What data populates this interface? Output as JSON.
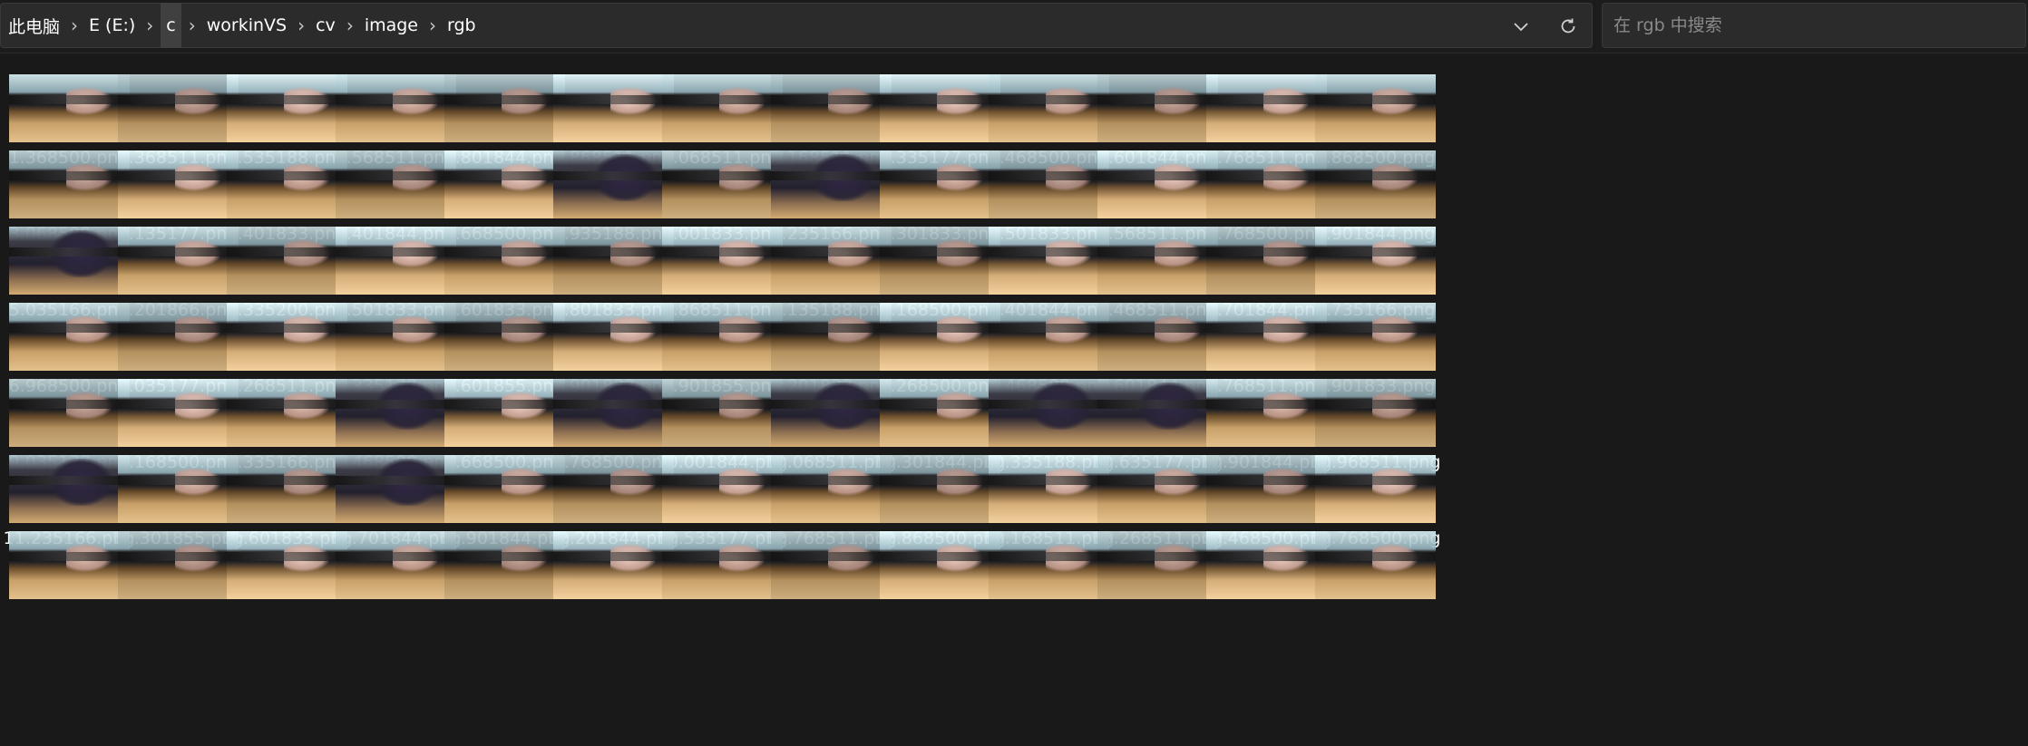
{
  "breadcrumb": [
    {
      "label": "此电脑",
      "highlight": false
    },
    {
      "label": "E (E:)",
      "highlight": false
    },
    {
      "label": "c",
      "highlight": true
    },
    {
      "label": "workinVS",
      "highlight": false
    },
    {
      "label": "cv",
      "highlight": false
    },
    {
      "label": "image",
      "highlight": false
    },
    {
      "label": "rgb",
      "highlight": false
    }
  ],
  "separator": "›",
  "address_actions": {
    "dropdown_icon": "chevron-down-icon",
    "refresh_icon": "refresh-icon"
  },
  "search": {
    "placeholder": "在 rgb 中搜索",
    "value": ""
  },
  "colors": {
    "background": "#191919",
    "bar": "#2b2b2b",
    "text": "#ffffff",
    "placeholder": "#8a8a8a"
  },
  "files": [
    "1.368500.png",
    "1.368511.png",
    "1.535188.png",
    "1.568511.png",
    "1.801844.png",
    "1.868511.png",
    "2.068511.png",
    "2.168511.png",
    "2.335177.png",
    "2.468500.png",
    "2.601844.png",
    "2.768511.png",
    "2.868500.png",
    "3.068500.png",
    "3.135177.png",
    "3.401833.png",
    "3.401844.png",
    "3.668500.png",
    "3.935188.png",
    "4.001833.png",
    "4.235166.png",
    "4.301833.png",
    "4.501833.png",
    "4.568511.png",
    "4.768500.png",
    "4.901844.png",
    "5.035166.png",
    "5.201866.png",
    "5.335200.png",
    "5.501833.png",
    "5.601833.png",
    "5.801833.png",
    "5.868511.png",
    "6.135188.png",
    "6.168500.png",
    "6.401844.png",
    "6.468511.png",
    "6.701844.png",
    "6.735166.png",
    "6.968500.png",
    "7.035177.png",
    "7.268511.png",
    "7.335177.png",
    "7.601855.png",
    "7.901833.png",
    "7.901855.png",
    "8.201833.png",
    "8.268500.png",
    "8.468500.png",
    "8.601844.png",
    "8.768511.png",
    "8.901833.png",
    "9.035177.png",
    "9.168500.png",
    "9.335166.png",
    "9.468500.png",
    "9.668500.png",
    "9.768500.png",
    "10.001844.png",
    "10.068511.png",
    "10.301844.png",
    "10.335188.png",
    "10.635177.png",
    "10.901844.png",
    "10.968511.png",
    "11.235166.png",
    "11.301855.png",
    "11.601833.png",
    "11.701844.png",
    "11.901844.png",
    "12.201844.png",
    "12.535177.png",
    "12.768511.png",
    "12.868500.png",
    "13.168511.png",
    "13.268511.png",
    "13.468500.png",
    "13.768500.png"
  ],
  "dark_thumbnails": [
    "3.935188.png",
    "4.235166.png",
    "5.035166.png",
    "9.468500.png",
    "9.768500.png",
    "10.068511.png",
    "10.335188.png",
    "10.635177.png",
    "11.235166.png",
    "11.701844.png"
  ],
  "next_row_partially_visible": true
}
